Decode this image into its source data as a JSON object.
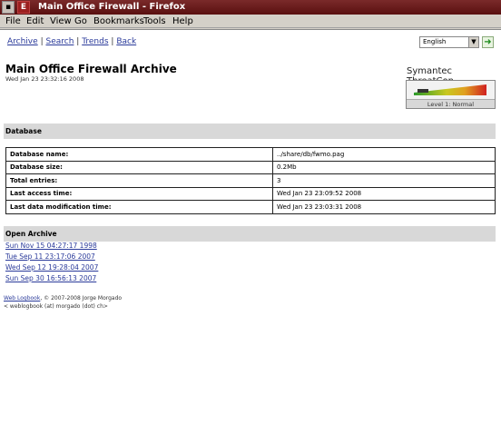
{
  "window": {
    "title": "Main Office Firewall - Firefox"
  },
  "menubar": [
    "File",
    "Edit",
    "View",
    "Go",
    "Bookmarks",
    "Tools",
    "Help"
  ],
  "nav": {
    "archive": "Archive",
    "search": "Search",
    "trends": "Trends",
    "back": "Back",
    "sep": "|"
  },
  "language": {
    "selected": "English"
  },
  "page": {
    "title": "Main Office Firewall Archive",
    "date": "Wed Jan 23 23:32:16 2008"
  },
  "threatcon": {
    "title": "Symantec ThreatCon",
    "level": "Level 1: Normal"
  },
  "database": {
    "header": "Database",
    "rows": [
      {
        "k": "Database name:",
        "v": "../share/db/fwmo.pag"
      },
      {
        "k": "Database size:",
        "v": "0.2Mb"
      },
      {
        "k": "Total entries:",
        "v": "3"
      },
      {
        "k": "Last access time:",
        "v": "Wed Jan 23 23:09:52 2008"
      },
      {
        "k": "Last data modification time:",
        "v": "Wed Jan 23 23:03:31 2008"
      }
    ]
  },
  "open_archive": {
    "header": "Open Archive",
    "items": [
      "Sun Nov 15 04:27:17 1998",
      "Tue Sep 11 23:17:06 2007",
      "Wed Sep 12 19:28:04 2007",
      "Sun Sep 30 16:56:13 2007"
    ]
  },
  "footer": {
    "link": "Web Logbook",
    "copyright": ", © 2007-2008 Jorge Morgado",
    "email": "< weblogbook (at) morgado (dot) ch>"
  }
}
